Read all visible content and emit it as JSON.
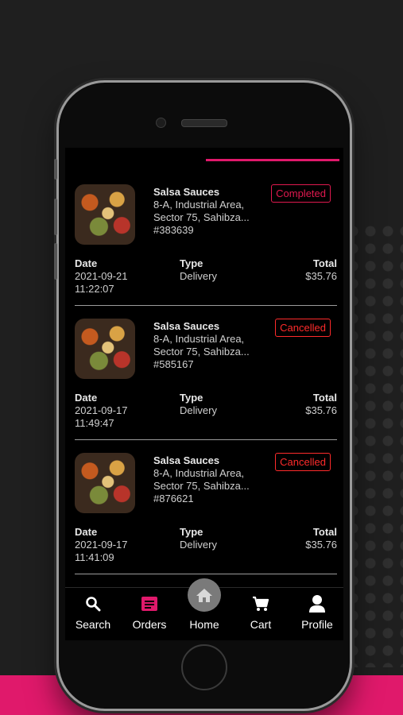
{
  "orders": [
    {
      "restaurant": "Salsa Sauces",
      "address_line1": "8-A, Industrial Area,",
      "address_line2": "Sector 75, Sahibza...",
      "order_number": "#383639",
      "status": "Completed",
      "date_label": "Date",
      "date": "2021-09-21",
      "time": "11:22:07",
      "type_label": "Type",
      "type": "Delivery",
      "total_label": "Total",
      "total": "$35.76"
    },
    {
      "restaurant": "Salsa Sauces",
      "address_line1": "8-A, Industrial Area,",
      "address_line2": "Sector 75, Sahibza...",
      "order_number": "#585167",
      "status": "Cancelled",
      "date_label": "Date",
      "date": "2021-09-17",
      "time": "11:49:47",
      "type_label": "Type",
      "type": "Delivery",
      "total_label": "Total",
      "total": "$35.76"
    },
    {
      "restaurant": "Salsa Sauces",
      "address_line1": "8-A, Industrial Area,",
      "address_line2": "Sector 75, Sahibza...",
      "order_number": "#876621",
      "status": "Cancelled",
      "date_label": "Date",
      "date": "2021-09-17",
      "time": "11:41:09",
      "type_label": "Type",
      "type": "Delivery",
      "total_label": "Total",
      "total": "$35.76"
    }
  ],
  "nav": {
    "search": {
      "label": "Search",
      "icon": "search-icon"
    },
    "orders": {
      "label": "Orders",
      "icon": "orders-icon",
      "active": true
    },
    "home": {
      "label": "Home",
      "icon": "home-icon"
    },
    "cart": {
      "label": "Cart",
      "icon": "cart-icon"
    },
    "profile": {
      "label": "Profile",
      "icon": "profile-icon"
    }
  },
  "colors": {
    "accent": "#e0196b",
    "status_completed": "#e0194f",
    "status_cancelled": "#ff2b2b",
    "screen_bg": "#000000"
  }
}
